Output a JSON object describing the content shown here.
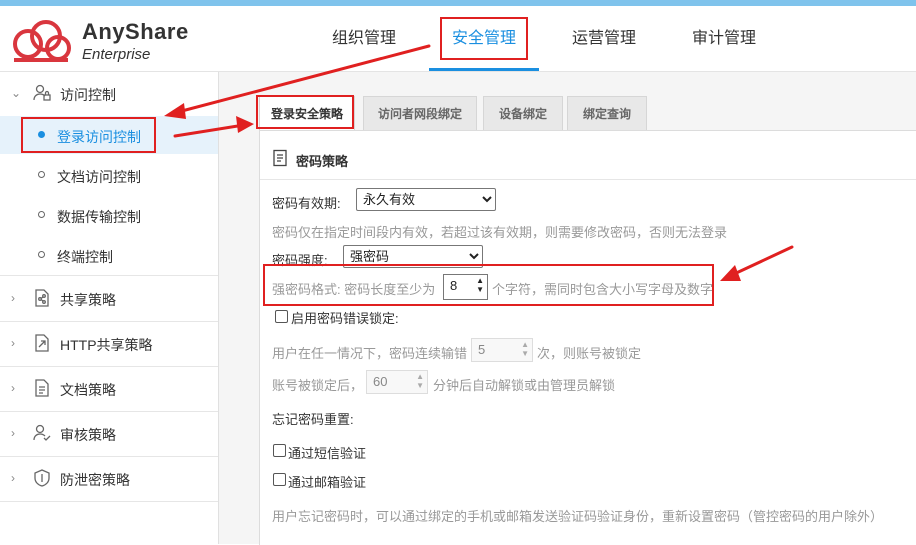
{
  "app": {
    "brand": "AnyShare",
    "sub": "Enterprise"
  },
  "nav": [
    "组织管理",
    "安全管理",
    "运营管理",
    "审计管理"
  ],
  "sidebar": {
    "groups": [
      {
        "label": "访问控制",
        "icon": "user-lock-icon",
        "expanded": true
      },
      {
        "label": "共享策略",
        "icon": "share-doc-icon"
      },
      {
        "label": "HTTP共享策略",
        "icon": "http-share-icon"
      },
      {
        "label": "文档策略",
        "icon": "document-icon"
      },
      {
        "label": "审核策略",
        "icon": "user-check-icon"
      },
      {
        "label": "防泄密策略",
        "icon": "shield-icon"
      }
    ],
    "sub": [
      "登录访问控制",
      "文档访问控制",
      "数据传输控制",
      "终端控制"
    ]
  },
  "tabs": [
    "登录安全策略",
    "访问者网段绑定",
    "设备绑定",
    "绑定查询"
  ],
  "panel": {
    "title": "密码策略",
    "validity_label": "密码有效期:",
    "validity_value": "永久有效",
    "validity_hint": "密码仅在指定时间段内有效，若超过该有效期，则需要修改密码，否则无法登录",
    "strength_label": "密码强度:",
    "strength_value": "强密码",
    "format_prefix": "强密码格式: 密码长度至少为",
    "format_length": "8",
    "format_suffix": "个字符，需同时包含大小写字母及数字",
    "lock_label": "启用密码错误锁定:",
    "lock_prefix": "用户在任一情况下，密码连续输错",
    "lock_count": "5",
    "lock_suffix": "次，则账号被锁定",
    "unlock_prefix": "账号被锁定后，",
    "unlock_minutes": "60",
    "unlock_suffix": "分钟后自动解锁或由管理员解锁",
    "reset_label": "忘记密码重置:",
    "sms_label": "通过短信验证",
    "email_label": "通过邮箱验证",
    "reset_hint": "用户忘记密码时，可以通过绑定的手机或邮箱发送验证码验证身份，重新设置密码（管控密码的用户除外）"
  },
  "colors": {
    "accent": "#1a8fe0",
    "annotation": "#e02020",
    "logo": "#d9363e"
  }
}
